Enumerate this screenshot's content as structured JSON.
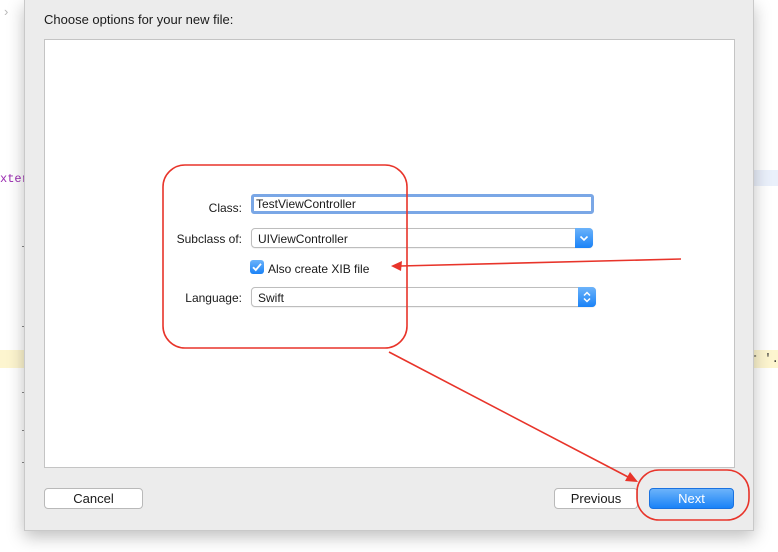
{
  "editor_background": {
    "left_fragment": "xter",
    "right_fragment": "r '.g..."
  },
  "dialog": {
    "title": "Choose options for your new file:",
    "form": {
      "class_label": "Class:",
      "class_value": "TestViewController",
      "subclass_label": "Subclass of:",
      "subclass_value": "UIViewController",
      "xib_checkbox_label": "Also create XIB file",
      "xib_checked": true,
      "language_label": "Language:",
      "language_value": "Swift"
    },
    "buttons": {
      "cancel": "Cancel",
      "previous": "Previous",
      "next": "Next"
    }
  },
  "icons": {
    "back_chevron": "chevron-right-icon",
    "popup_arrow": "chevron-updown-icon",
    "checkbox": "checkmark-icon"
  },
  "colors": {
    "annotation": "#e8342a",
    "accent": "#1a82f7"
  }
}
